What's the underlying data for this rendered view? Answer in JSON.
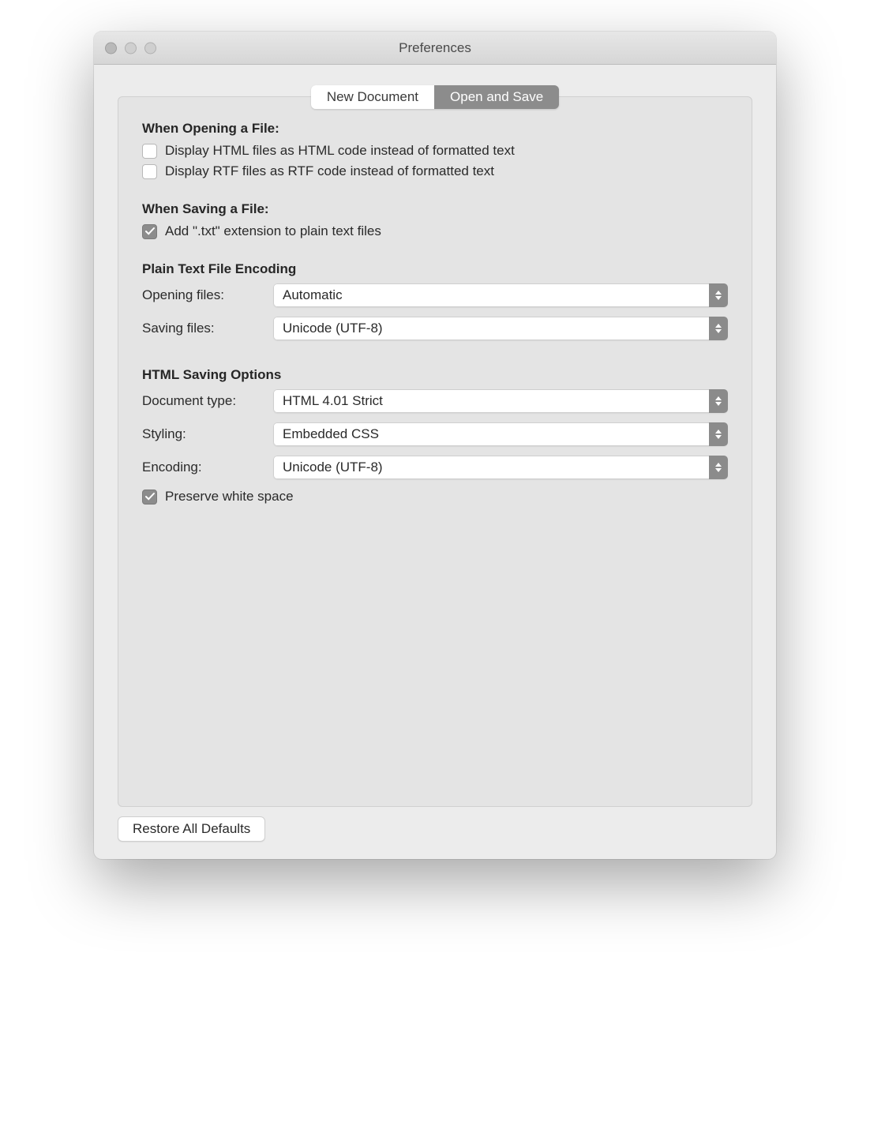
{
  "window": {
    "title": "Preferences"
  },
  "tabs": {
    "new_document": "New Document",
    "open_and_save": "Open and Save"
  },
  "sections": {
    "opening_title": "When Opening a File:",
    "opening_html_label": "Display HTML files as HTML code instead of formatted text",
    "opening_rtf_label": "Display RTF files as RTF code instead of formatted text",
    "saving_title": "When Saving a File:",
    "saving_txt_ext_label": "Add \".txt\" extension to plain text files",
    "plain_text_encoding_title": "Plain Text File Encoding",
    "opening_files_label": "Opening files:",
    "opening_files_value": "Automatic",
    "saving_files_label": "Saving files:",
    "saving_files_value": "Unicode (UTF-8)",
    "html_saving_title": "HTML Saving Options",
    "document_type_label": "Document type:",
    "document_type_value": "HTML 4.01 Strict",
    "styling_label": "Styling:",
    "styling_value": "Embedded CSS",
    "encoding_label": "Encoding:",
    "encoding_value": "Unicode (UTF-8)",
    "preserve_ws_label": "Preserve white space"
  },
  "footer": {
    "restore_defaults": "Restore All Defaults"
  },
  "state": {
    "opening_html_checked": false,
    "opening_rtf_checked": false,
    "saving_txt_ext_checked": true,
    "preserve_ws_checked": true
  }
}
